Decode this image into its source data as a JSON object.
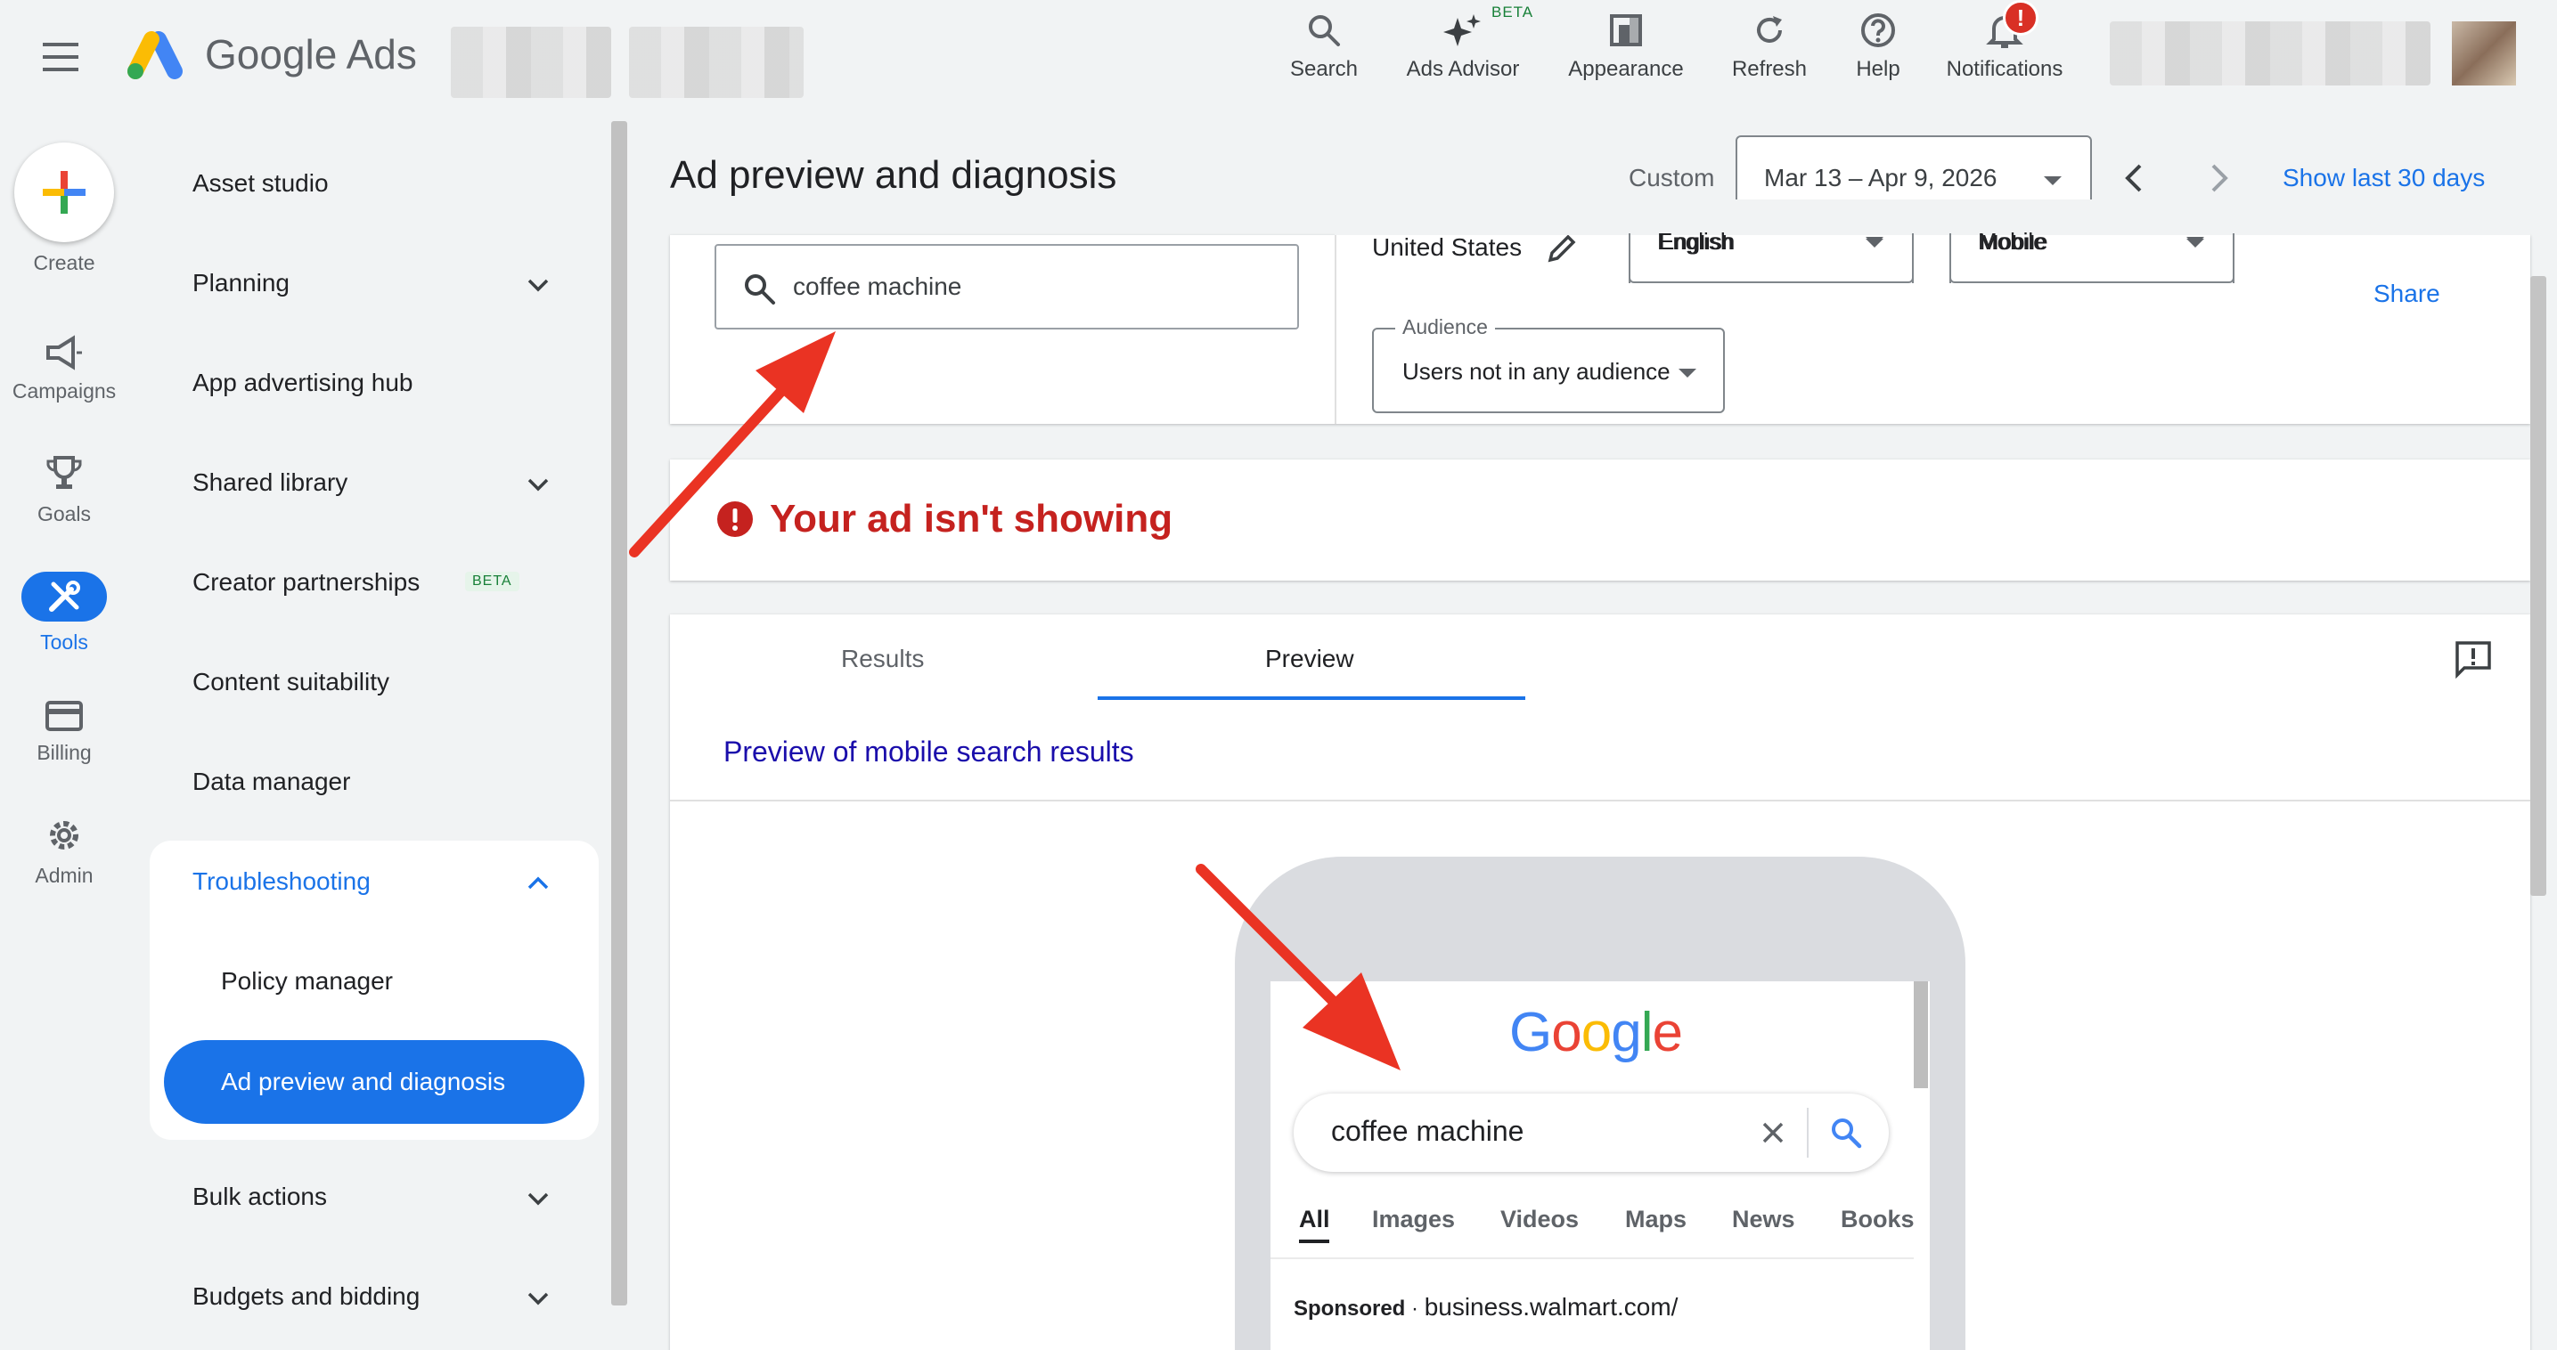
{
  "app": {
    "brand": "Google Ads"
  },
  "topnav": [
    {
      "label": "Search",
      "icon": "search-icon"
    },
    {
      "label": "Ads Advisor",
      "icon": "sparkle-icon",
      "badge": "BETA"
    },
    {
      "label": "Appearance",
      "icon": "appearance-icon"
    },
    {
      "label": "Refresh",
      "icon": "refresh-icon"
    },
    {
      "label": "Help",
      "icon": "help-icon"
    },
    {
      "label": "Notifications",
      "icon": "bell-icon",
      "badge": "!"
    }
  ],
  "rail": {
    "create": "Create",
    "campaigns": "Campaigns",
    "goals": "Goals",
    "tools": "Tools",
    "billing": "Billing",
    "admin": "Admin"
  },
  "menu": {
    "asset_studio": "Asset studio",
    "planning": "Planning",
    "app_hub": "App advertising hub",
    "shared_library": "Shared library",
    "creator": "Creator partnerships",
    "creator_badge": "BETA",
    "content_suitability": "Content suitability",
    "data_manager": "Data manager",
    "troubleshooting": "Troubleshooting",
    "policy_manager": "Policy manager",
    "ad_preview": "Ad preview and diagnosis",
    "bulk_actions": "Bulk actions",
    "budgets": "Budgets and bidding"
  },
  "header": {
    "title": "Ad preview and diagnosis",
    "range_type": "Custom",
    "date_range": "Mar 13 – Apr 9, 2026",
    "show_last": "Show last 30 days"
  },
  "filters": {
    "query": "coffee machine",
    "location": "United States",
    "language": "English",
    "device": "Mobile",
    "share": "Share",
    "audience_label": "Audience",
    "audience_value": "Users not in any audience"
  },
  "status": {
    "message": "Your ad isn't showing"
  },
  "tabs": {
    "results": "Results",
    "preview": "Preview",
    "active": "Preview"
  },
  "preview": {
    "heading": "Preview of mobile search results",
    "query": "coffee machine",
    "google_tabs": [
      "All",
      "Images",
      "Videos",
      "Maps",
      "News",
      "Books"
    ],
    "sponsored": "Sponsored",
    "url": "business.walmart.com/"
  },
  "colors": {
    "accent": "#1a73e8",
    "error": "#c5221f",
    "annotation_arrow": "#ea3323"
  }
}
